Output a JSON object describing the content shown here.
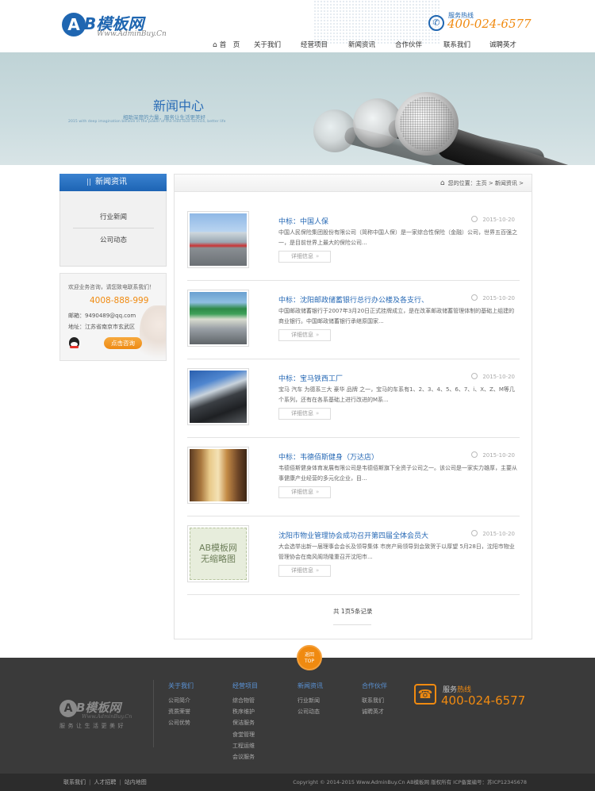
{
  "header": {
    "logo_mark": "A",
    "logo_text": "B模板网",
    "logo_sub": "Www.AdminBuy.Cn",
    "hotline_label": "服务热线",
    "hotline_number": "400-024-6577"
  },
  "nav": {
    "items": [
      "首　页",
      "关于我们",
      "经营项目",
      "新闻资讯",
      "合作伙伴",
      "联系我们",
      "诚聘英才"
    ]
  },
  "banner": {
    "title": "新闻中心",
    "subtitle": "相助深度的力量，服务让生活更美好",
    "subtitle_en": "2015 with deep imagination believe in the power of the men love service, better life"
  },
  "sidebar": {
    "heading": "新闻资讯",
    "links": [
      "行业新闻",
      "公司动态"
    ],
    "contact": {
      "intro": "欢迎业务咨询，请您致电联系我们！",
      "phone": "4008-888-999",
      "email": "邮箱：9490489@qq.com",
      "address": "地址：江苏省南京市玄武区",
      "consult_button": "点击咨询"
    }
  },
  "breadcrumb": {
    "text": "您的位置：主页 > 新闻资讯 >"
  },
  "news": {
    "more_label": "详细信息",
    "items": [
      {
        "title": "中标：中国人保",
        "date": "2015-10-20",
        "desc": "中国人民保险集团股份有限公司（简称中国人保）是一家综合性保险（金融）公司，世界五百强之一，是目前世界上最大的保险公司..."
      },
      {
        "title": "中标：沈阳邮政储蓄银行总行办公楼及各支行、",
        "date": "2015-10-20",
        "desc": "中国邮政储蓄银行于2007年3月20日正式挂牌成立，是在改革邮政储蓄管理体制的基础上组建的商业银行。中国邮政储蓄银行承继原国家..."
      },
      {
        "title": "中标：宝马铁西工厂",
        "date": "2015-10-20",
        "desc": "宝马 汽车 为德系三大 豪华 品牌 之一，宝马的车系有1、2、3、4、5、6、7、i、X、Z、M等几个系列，还有在各系基础上进行改进的M系..."
      },
      {
        "title": "中标：韦德佰斯健身（万达店）",
        "date": "2015-10-20",
        "desc": "韦德佰斯健身体育发展有限公司是韦德佰斯旗下全资子公司之一。该公司是一家实力雄厚，主要从事健康产业经营的多元化企业，目..."
      },
      {
        "title": "沈阳市物业管理协会成功召开第四届全体会员大",
        "date": "2015-10-20",
        "desc": "大会选举出新一届理事会会长及领导集体 市房产局领导到会致贺于以厚望 5月28日，沈阳市物业管理协会在南风阁场隆重召开沈阳市...",
        "thumb_text_1": "AB模板网",
        "thumb_text_2": "无缩略图"
      }
    ]
  },
  "pager": {
    "text": "共 1页5条记录"
  },
  "footer": {
    "top_label_1": "返回",
    "top_label_2": "TOP",
    "logo_mark": "A",
    "logo_text": "B模板网",
    "logo_sub": "Www.AdminBuy.Cn",
    "slogan": "服务让生活更美好",
    "columns": [
      {
        "heading": "关于我们",
        "items": [
          "公司简介",
          "资质荣誉",
          "公司优势"
        ]
      },
      {
        "heading": "经营项目",
        "items": [
          "综合物管",
          "秩序维护",
          "保洁服务",
          "食堂管理",
          "工程运维",
          "会议服务"
        ]
      },
      {
        "heading": "新闻资讯",
        "items": [
          "行业新闻",
          "公司动态"
        ]
      },
      {
        "heading": "合作伙伴",
        "items": [
          "联系我们",
          "诚聘英才"
        ]
      }
    ],
    "hotline_label_a": "服务",
    "hotline_label_b": "热线",
    "hotline_number": "400-024-6577"
  },
  "bottom": {
    "links": [
      "联系我们",
      "人才招聘",
      "站内地图"
    ],
    "copyright": "Copyright © 2014-2015 Www.AdminBuy.Cn AB模板网 版权所有  ICP备案编号：苏ICP12345678"
  },
  "colors": {
    "brand_blue": "#1f66b1",
    "accent_orange": "#f08a10",
    "footer_bg": "#3a3a3a"
  }
}
